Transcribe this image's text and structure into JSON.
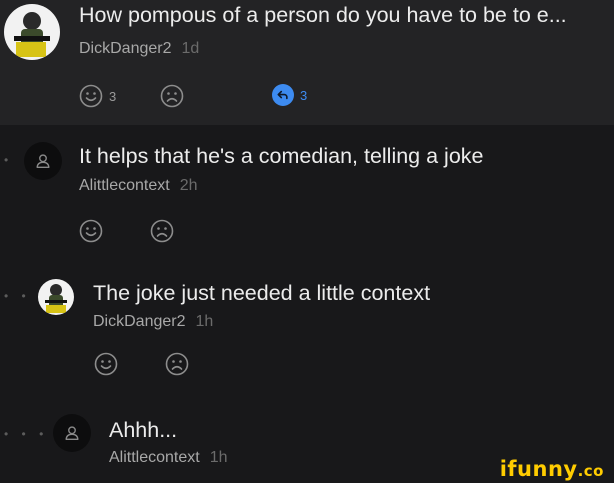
{
  "post": {
    "title": "How pompous of a person do you have to be to e...",
    "author": "DickDanger2",
    "time": "1d",
    "smile_count": "3",
    "reply_count": "3",
    "avatar_text": "DICK DANGER"
  },
  "comments": [
    {
      "text": "It helps that he's a comedian, telling a joke",
      "author": "Alittlecontext",
      "time": "2h",
      "depth_dots": "•"
    },
    {
      "text": "The joke just needed a little context",
      "author": "DickDanger2",
      "time": "1h",
      "depth_dots": "• •"
    },
    {
      "text": "Ahhh...",
      "author": "Alittlecontext",
      "time": "1h",
      "depth_dots": "• • •"
    }
  ],
  "watermark": {
    "main": "ifunny",
    "suffix": ".co"
  },
  "colors": {
    "background": "#18181a",
    "post_background": "#232325",
    "accent": "#3d8bf0",
    "watermark": "#ffcc00"
  }
}
